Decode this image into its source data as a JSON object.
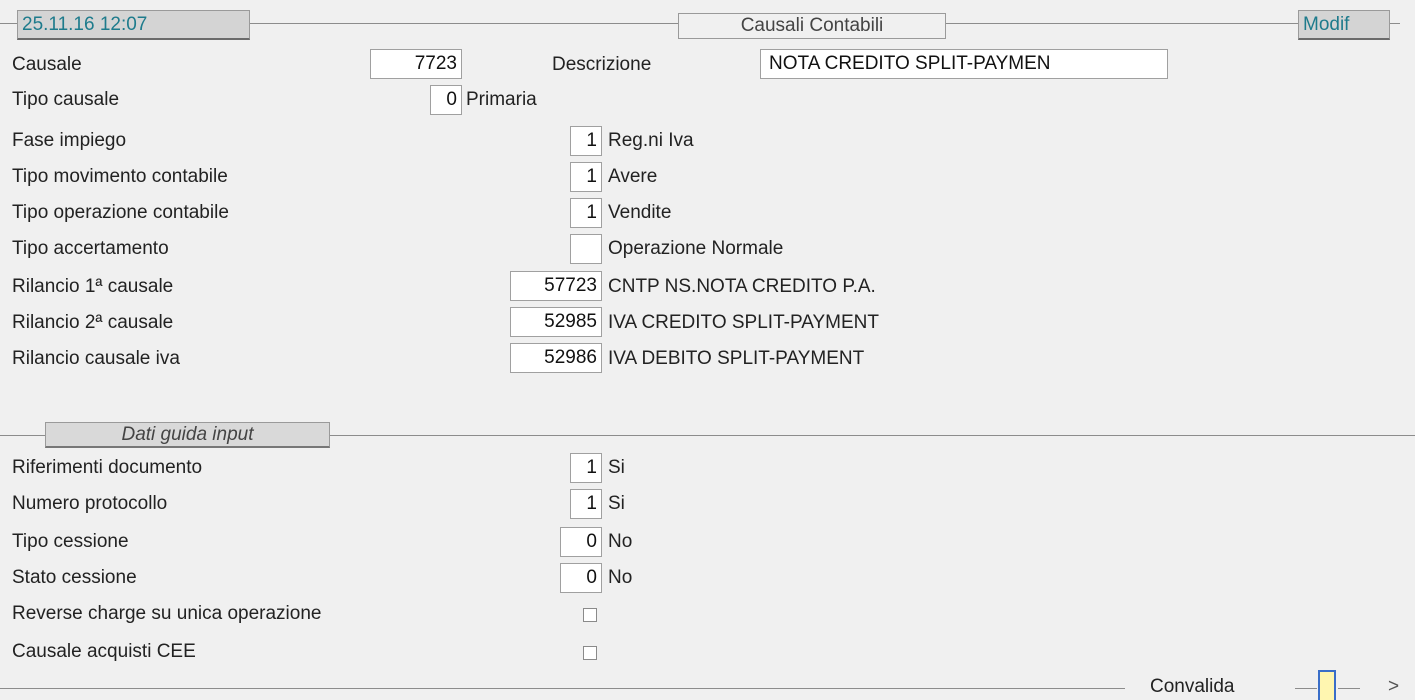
{
  "header": {
    "datetime": "25.11.16 12:07",
    "title": "Causali Contabili",
    "mode": "Modif"
  },
  "main": {
    "causale": {
      "label": "Causale",
      "value": "7723"
    },
    "descrizione": {
      "label": "Descrizione",
      "value": "NOTA CREDITO SPLIT-PAYMEN"
    },
    "tipo_causale": {
      "label": "Tipo causale",
      "value": "0",
      "desc": "Primaria"
    },
    "fase_impiego": {
      "label": "Fase impiego",
      "value": "1",
      "desc": "Reg.ni Iva"
    },
    "tipo_movimento": {
      "label": "Tipo movimento contabile",
      "value": "1",
      "desc": "Avere"
    },
    "tipo_operazione": {
      "label": "Tipo operazione contabile",
      "value": "1",
      "desc": "Vendite"
    },
    "tipo_accertamento": {
      "label": "Tipo accertamento",
      "value": "",
      "desc": "Operazione Normale"
    },
    "rilancio1": {
      "label": "Rilancio 1ª causale",
      "value": "57723",
      "desc": "CNTP NS.NOTA CREDITO P.A."
    },
    "rilancio2": {
      "label": "Rilancio 2ª causale",
      "value": "52985",
      "desc": "IVA CREDITO SPLIT-PAYMENT"
    },
    "rilancio_iva": {
      "label": "Rilancio causale iva",
      "value": "52986",
      "desc": "IVA DEBITO SPLIT-PAYMENT"
    }
  },
  "guida": {
    "section_title": "Dati guida input",
    "rif_documento": {
      "label": "Riferimenti documento",
      "value": "1",
      "desc": "Si"
    },
    "num_protocollo": {
      "label": "Numero protocollo",
      "value": "1",
      "desc": "Si"
    },
    "tipo_cessione": {
      "label": "Tipo cessione",
      "value": "0",
      "desc": "No"
    },
    "stato_cessione": {
      "label": "Stato cessione",
      "value": "0",
      "desc": "No"
    },
    "reverse_charge": {
      "label": "Reverse charge su unica operazione",
      "checked": false
    },
    "acquisti_cee": {
      "label": "Causale acquisti CEE",
      "checked": false
    }
  },
  "footer": {
    "convalida_label": "Convalida",
    "next_label": ">"
  }
}
